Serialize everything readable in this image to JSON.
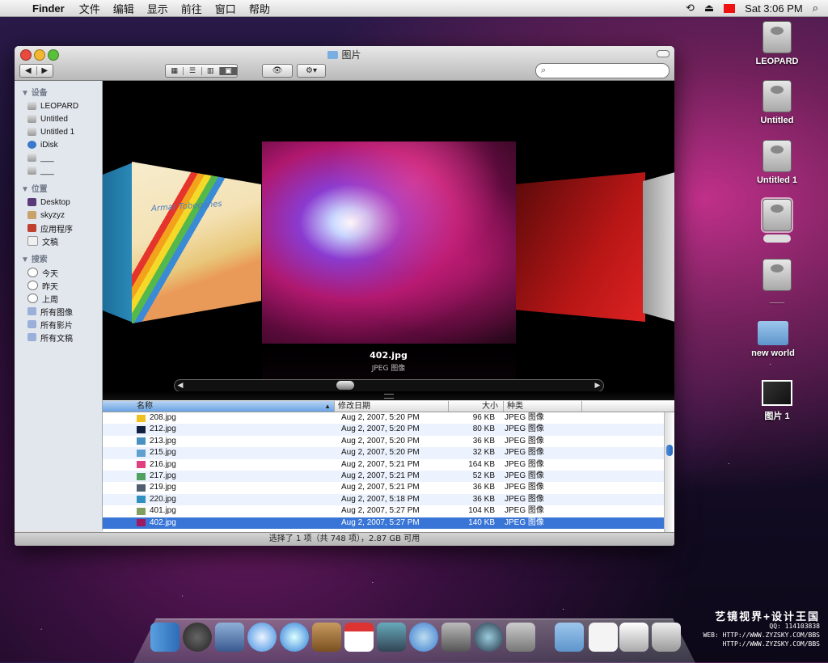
{
  "menubar": {
    "app": "Finder",
    "items": [
      "文件",
      "编辑",
      "显示",
      "前往",
      "窗口",
      "帮助"
    ],
    "clock": "Sat 3:06 PM"
  },
  "desktop_icons": [
    {
      "label": "LEOPARD"
    },
    {
      "label": "Untitled"
    },
    {
      "label": "Untitled 1"
    },
    {
      "label": ""
    },
    {
      "label": "___"
    },
    {
      "label": "new world"
    },
    {
      "label": "图片 1"
    }
  ],
  "window": {
    "title": "图片",
    "sidebar": {
      "devices_header": "设备",
      "devices": [
        "LEOPARD",
        "Untitled",
        "Untitled 1",
        "iDisk",
        "___",
        "___"
      ],
      "places_header": "位置",
      "places": [
        "Desktop",
        "skyzyz",
        "应用程序",
        "文稿"
      ],
      "search_header": "搜索",
      "searches": [
        "今天",
        "昨天",
        "上周",
        "所有图像",
        "所有影片",
        "所有文稿"
      ]
    },
    "coverflow": {
      "left_caption": "Armar Tobogones",
      "selected_name": "402.jpg",
      "selected_kind": "JPEG 图像"
    },
    "columns": {
      "name": "名称",
      "date": "修改日期",
      "size": "大小",
      "kind": "种类"
    },
    "files": [
      {
        "name": "208.jpg",
        "date": "Aug 2, 2007, 5:20 PM",
        "size": "96 KB",
        "kind": "JPEG 图像",
        "color": "#f0c020"
      },
      {
        "name": "212.jpg",
        "date": "Aug 2, 2007, 5:20 PM",
        "size": "80 KB",
        "kind": "JPEG 图像",
        "color": "#102040"
      },
      {
        "name": "213.jpg",
        "date": "Aug 2, 2007, 5:20 PM",
        "size": "36 KB",
        "kind": "JPEG 图像",
        "color": "#4a90c0"
      },
      {
        "name": "215.jpg",
        "date": "Aug 2, 2007, 5:20 PM",
        "size": "32 KB",
        "kind": "JPEG 图像",
        "color": "#60a0d0"
      },
      {
        "name": "216.jpg",
        "date": "Aug 2, 2007, 5:21 PM",
        "size": "164 KB",
        "kind": "JPEG 图像",
        "color": "#e04080"
      },
      {
        "name": "217.jpg",
        "date": "Aug 2, 2007, 5:21 PM",
        "size": "52 KB",
        "kind": "JPEG 图像",
        "color": "#50a060"
      },
      {
        "name": "219.jpg",
        "date": "Aug 2, 2007, 5:21 PM",
        "size": "36 KB",
        "kind": "JPEG 图像",
        "color": "#506070"
      },
      {
        "name": "220.jpg",
        "date": "Aug 2, 2007, 5:18 PM",
        "size": "36 KB",
        "kind": "JPEG 图像",
        "color": "#3090c0"
      },
      {
        "name": "401.jpg",
        "date": "Aug 2, 2007, 5:27 PM",
        "size": "104 KB",
        "kind": "JPEG 图像",
        "color": "#80a060"
      },
      {
        "name": "402.jpg",
        "date": "Aug 2, 2007, 5:27 PM",
        "size": "140 KB",
        "kind": "JPEG 图像",
        "color": "#a01860",
        "selected": true
      }
    ],
    "status": "选择了 1 项（共 748 项），2.87 GB 可用"
  },
  "credit": {
    "title": "艺镜视界+设计王国",
    "line1": "QQ:        114103838",
    "line2": "WEB: HTTP://WWW.ZYZSKY.COM/BBS",
    "line3": "HTTP://WWW.ZYZSKY.COM/BBS"
  }
}
